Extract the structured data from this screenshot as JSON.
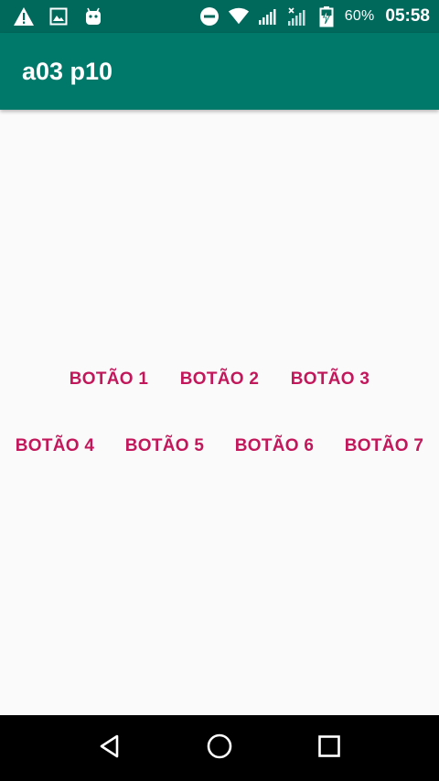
{
  "status_bar": {
    "icons_left": [
      "warning-icon",
      "image-icon",
      "android-icon"
    ],
    "icons_right": [
      "do-not-disturb-icon",
      "wifi-icon",
      "signal-icon",
      "signal-no-data-icon",
      "battery-charging-icon"
    ],
    "battery_percent": "60%",
    "time": "05:58"
  },
  "app_bar": {
    "title": "a03 p10",
    "color": "#00796b"
  },
  "buttons": {
    "accent_color": "#c2185b",
    "row1": [
      {
        "label": "BOTÃO 1"
      },
      {
        "label": "BOTÃO 2"
      },
      {
        "label": "BOTÃO 3"
      }
    ],
    "row2": [
      {
        "label": "BOTÃO 4"
      },
      {
        "label": "BOTÃO 5"
      },
      {
        "label": "BOTÃO 6"
      },
      {
        "label": "BOTÃO 7"
      }
    ]
  },
  "nav_bar": {
    "icons": [
      "back-icon",
      "home-icon",
      "recents-icon"
    ]
  }
}
